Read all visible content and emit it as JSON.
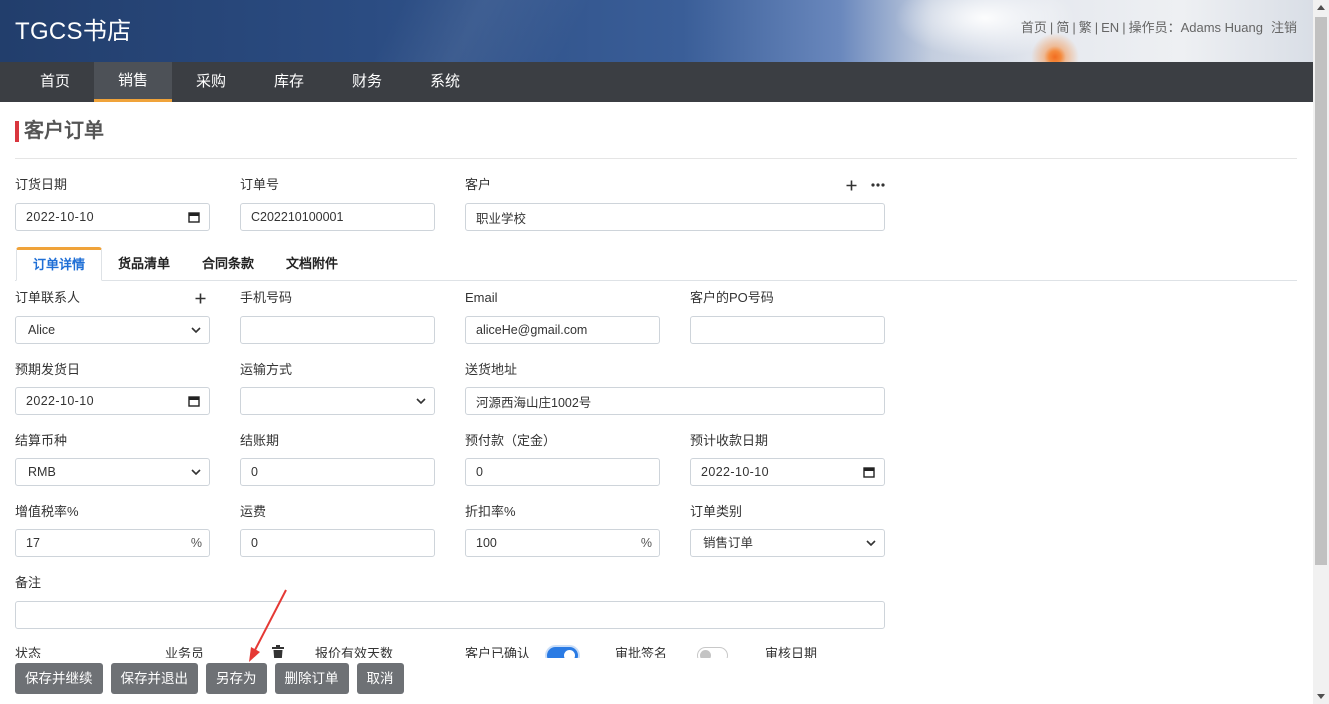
{
  "app": {
    "title": "TGCS书店"
  },
  "top_links": {
    "home": "首页",
    "separator": "|",
    "simplified": "简",
    "traditional": "繁",
    "english": "EN",
    "operator_label": "操作员：",
    "operator_name": "Adams Huang",
    "logout": "注销"
  },
  "nav": {
    "items": [
      {
        "label": "首页",
        "active": false
      },
      {
        "label": "销售",
        "active": true
      },
      {
        "label": "采购",
        "active": false
      },
      {
        "label": "库存",
        "active": false
      },
      {
        "label": "财务",
        "active": false
      },
      {
        "label": "系统",
        "active": false
      }
    ]
  },
  "page": {
    "title": "客户订单"
  },
  "order_header": {
    "order_date": {
      "label": "订货日期",
      "value": "2022-10-10"
    },
    "order_no": {
      "label": "订单号",
      "value": "C202210100001"
    },
    "customer": {
      "label": "客户",
      "value": "职业学校"
    }
  },
  "tabs": [
    {
      "label": "订单详情",
      "active": true
    },
    {
      "label": "货品清单",
      "active": false
    },
    {
      "label": "合同条款",
      "active": false
    },
    {
      "label": "文档附件",
      "active": false
    }
  ],
  "details": {
    "contact": {
      "label": "订单联系人",
      "value": "Alice"
    },
    "mobile": {
      "label": "手机号码",
      "value": ""
    },
    "email": {
      "label": "Email",
      "value": "aliceHe@gmail.com"
    },
    "customer_po": {
      "label": "客户的PO号码",
      "value": ""
    },
    "expected_ship_date": {
      "label": "预期发货日",
      "value": "2022-10-10"
    },
    "shipping_method": {
      "label": "运输方式",
      "value": ""
    },
    "delivery_address": {
      "label": "送货地址",
      "value": "河源西海山庄1002号"
    },
    "currency": {
      "label": "结算币种",
      "value": "RMB"
    },
    "payment_term": {
      "label": "结账期",
      "value": "0"
    },
    "prepayment": {
      "label": "预付款（定金）",
      "value": "0"
    },
    "expected_receipt_date": {
      "label": "预计收款日期",
      "value": "2022-10-10"
    },
    "vat_rate": {
      "label": "增值税率%",
      "value": "17",
      "suffix": "%"
    },
    "freight": {
      "label": "运费",
      "value": "0"
    },
    "discount_rate": {
      "label": "折扣率%",
      "value": "100",
      "suffix": "%"
    },
    "order_type": {
      "label": "订单类别",
      "value": "销售订单"
    },
    "remark": {
      "label": "备注",
      "value": ""
    },
    "status": {
      "label": "状态"
    },
    "salesperson": {
      "label": "业务员"
    },
    "quote_valid_days": {
      "label": "报价有效天数"
    },
    "customer_confirmed": {
      "label": "客户已确认",
      "on": true
    },
    "approval_signature": {
      "label": "审批签名",
      "on": false
    },
    "review_date": {
      "label": "审核日期"
    }
  },
  "actions": {
    "save_continue": "保存并继续",
    "save_exit": "保存并退出",
    "save_as": "另存为",
    "delete_order": "删除订单",
    "cancel": "取消"
  },
  "icons": {
    "customer_add": "plus-icon",
    "customer_more": "more-icon",
    "contact_add": "plus-icon",
    "date_picker": "calendar-icon",
    "select_arrow": "chevron-down-icon",
    "salesperson_clear": "trash-icon"
  },
  "colors": {
    "nav-bg": "#3b3e43",
    "nav-active-bg": "#4d5157",
    "accent-orange": "#f0a33a",
    "title-bar": "#d9363e",
    "tab-active-text": "#1f6fd6",
    "button-bg": "#6e7175",
    "toggle-on": "#2a7be4",
    "annotation": "#e53935"
  }
}
